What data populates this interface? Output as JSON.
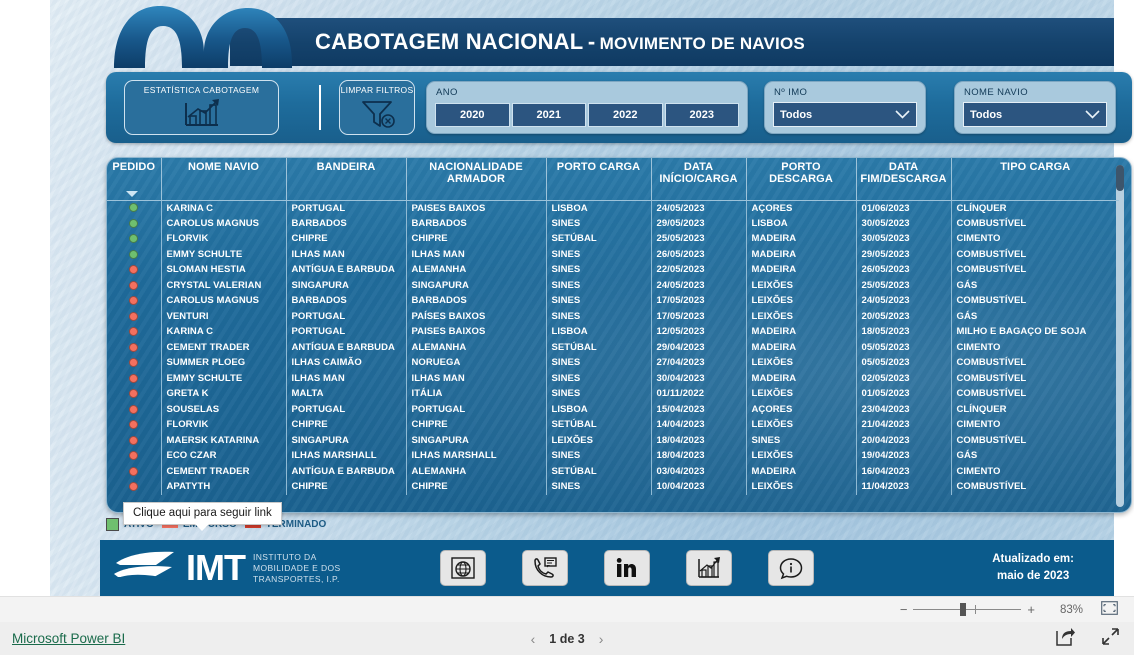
{
  "header": {
    "title_main": "CABOTAGEM NACIONAL",
    "title_dash": "-",
    "title_sub": "MOVIMENTO DE NAVIOS"
  },
  "filters": {
    "estatistica_button": "ESTATÍSTICA CABOTAGEM",
    "limpar_button": "LIMPAR FILTROS",
    "ano_label": "ANO",
    "years": [
      "2020",
      "2021",
      "2022",
      "2023"
    ],
    "imo_label": "Nº IMO",
    "imo_value": "Todos",
    "navio_label": "NOME NAVIO",
    "navio_value": "Todos"
  },
  "table": {
    "columns": [
      "PEDIDO",
      "NOME NAVIO",
      "BANDEIRA",
      "NACIONALIDADE ARMADOR",
      "PORTO CARGA",
      "DATA INÍCIO/CARGA",
      "PORTO DESCARGA",
      "DATA FIM/DESCARGA",
      "TIPO CARGA"
    ],
    "status_colors": {
      "green": "#6fbf6f",
      "red": "#f4705f"
    },
    "rows": [
      {
        "status": "green",
        "navio": "KARINA C",
        "bandeira": "PORTUGAL",
        "nacionalidade": "PAISES BAIXOS",
        "porto_carga": "LISBOA",
        "data_inicio": "24/05/2023",
        "porto_descarga": "AÇORES",
        "data_fim": "01/06/2023",
        "tipo_carga": "CLÍNQUER"
      },
      {
        "status": "green",
        "navio": "CAROLUS MAGNUS",
        "bandeira": "BARBADOS",
        "nacionalidade": "BARBADOS",
        "porto_carga": "SINES",
        "data_inicio": "29/05/2023",
        "porto_descarga": "LISBOA",
        "data_fim": "30/05/2023",
        "tipo_carga": "COMBUSTÍVEL"
      },
      {
        "status": "green",
        "navio": "FLORVIK",
        "bandeira": "CHIPRE",
        "nacionalidade": "CHIPRE",
        "porto_carga": "SETÚBAL",
        "data_inicio": "25/05/2023",
        "porto_descarga": "MADEIRA",
        "data_fim": "30/05/2023",
        "tipo_carga": "CIMENTO"
      },
      {
        "status": "green",
        "navio": "EMMY SCHULTE",
        "bandeira": "ILHAS MAN",
        "nacionalidade": "ILHAS MAN",
        "porto_carga": "SINES",
        "data_inicio": "26/05/2023",
        "porto_descarga": "MADEIRA",
        "data_fim": "29/05/2023",
        "tipo_carga": "COMBUSTÍVEL"
      },
      {
        "status": "red",
        "navio": "SLOMAN HESTIA",
        "bandeira": "ANTÍGUA E BARBUDA",
        "nacionalidade": "ALEMANHA",
        "porto_carga": "SINES",
        "data_inicio": "22/05/2023",
        "porto_descarga": "MADEIRA",
        "data_fim": "26/05/2023",
        "tipo_carga": "COMBUSTÍVEL"
      },
      {
        "status": "red",
        "navio": "CRYSTAL VALERIAN",
        "bandeira": "SINGAPURA",
        "nacionalidade": "SINGAPURA",
        "porto_carga": "SINES",
        "data_inicio": "24/05/2023",
        "porto_descarga": "LEIXÕES",
        "data_fim": "25/05/2023",
        "tipo_carga": "GÁS"
      },
      {
        "status": "red",
        "navio": "CAROLUS MAGNUS",
        "bandeira": "BARBADOS",
        "nacionalidade": "BARBADOS",
        "porto_carga": "SINES",
        "data_inicio": "17/05/2023",
        "porto_descarga": "LEIXÕES",
        "data_fim": "24/05/2023",
        "tipo_carga": "COMBUSTÍVEL"
      },
      {
        "status": "red",
        "navio": "VENTURI",
        "bandeira": "PORTUGAL",
        "nacionalidade": "PAÍSES BAIXOS",
        "porto_carga": "SINES",
        "data_inicio": "17/05/2023",
        "porto_descarga": "LEIXÕES",
        "data_fim": "20/05/2023",
        "tipo_carga": "GÁS"
      },
      {
        "status": "red",
        "navio": "KARINA C",
        "bandeira": "PORTUGAL",
        "nacionalidade": "PAISES BAIXOS",
        "porto_carga": "LISBOA",
        "data_inicio": "12/05/2023",
        "porto_descarga": "MADEIRA",
        "data_fim": "18/05/2023",
        "tipo_carga": "MILHO E BAGAÇO DE SOJA"
      },
      {
        "status": "red",
        "navio": "CEMENT TRADER",
        "bandeira": "ANTÍGUA E BARBUDA",
        "nacionalidade": "ALEMANHA",
        "porto_carga": "SETÚBAL",
        "data_inicio": "29/04/2023",
        "porto_descarga": "MADEIRA",
        "data_fim": "05/05/2023",
        "tipo_carga": "CIMENTO"
      },
      {
        "status": "red",
        "navio": "SUMMER PLOEG",
        "bandeira": "ILHAS CAIMÃO",
        "nacionalidade": "NORUEGA",
        "porto_carga": "SINES",
        "data_inicio": "27/04/2023",
        "porto_descarga": "LEIXÕES",
        "data_fim": "05/05/2023",
        "tipo_carga": "COMBUSTÍVEL"
      },
      {
        "status": "red",
        "navio": "EMMY SCHULTE",
        "bandeira": "ILHAS MAN",
        "nacionalidade": "ILHAS MAN",
        "porto_carga": "SINES",
        "data_inicio": "30/04/2023",
        "porto_descarga": "MADEIRA",
        "data_fim": "02/05/2023",
        "tipo_carga": "COMBUSTÍVEL"
      },
      {
        "status": "red",
        "navio": "GRETA K",
        "bandeira": "MALTA",
        "nacionalidade": "ITÁLIA",
        "porto_carga": "SINES",
        "data_inicio": "01/11/2022",
        "porto_descarga": "LEIXÕES",
        "data_fim": "01/05/2023",
        "tipo_carga": "COMBUSTÍVEL"
      },
      {
        "status": "red",
        "navio": "SOUSELAS",
        "bandeira": "PORTUGAL",
        "nacionalidade": "PORTUGAL",
        "porto_carga": "LISBOA",
        "data_inicio": "15/04/2023",
        "porto_descarga": "AÇORES",
        "data_fim": "23/04/2023",
        "tipo_carga": "CLÍNQUER"
      },
      {
        "status": "red",
        "navio": "FLORVIK",
        "bandeira": "CHIPRE",
        "nacionalidade": "CHIPRE",
        "porto_carga": "SETÚBAL",
        "data_inicio": "14/04/2023",
        "porto_descarga": "LEIXÕES",
        "data_fim": "21/04/2023",
        "tipo_carga": "CIMENTO"
      },
      {
        "status": "red",
        "navio": "MAERSK KATARINA",
        "bandeira": "SINGAPURA",
        "nacionalidade": "SINGAPURA",
        "porto_carga": "LEIXÕES",
        "data_inicio": "18/04/2023",
        "porto_descarga": "SINES",
        "data_fim": "20/04/2023",
        "tipo_carga": "COMBUSTÍVEL"
      },
      {
        "status": "red",
        "navio": "ECO CZAR",
        "bandeira": "ILHAS MARSHALL",
        "nacionalidade": "ILHAS MARSHALL",
        "porto_carga": "SINES",
        "data_inicio": "18/04/2023",
        "porto_descarga": "LEIXÕES",
        "data_fim": "19/04/2023",
        "tipo_carga": "GÁS"
      },
      {
        "status": "red",
        "navio": "CEMENT TRADER",
        "bandeira": "ANTÍGUA E BARBUDA",
        "nacionalidade": "ALEMANHA",
        "porto_carga": "SETÚBAL",
        "data_inicio": "03/04/2023",
        "porto_descarga": "MADEIRA",
        "data_fim": "16/04/2023",
        "tipo_carga": "CIMENTO"
      },
      {
        "status": "red",
        "navio": "APATYTH",
        "bandeira": "CHIPRE",
        "nacionalidade": "CHIPRE",
        "porto_carga": "SINES",
        "data_inicio": "10/04/2023",
        "porto_descarga": "LEIXÕES",
        "data_fim": "11/04/2023",
        "tipo_carga": "COMBUSTÍVEL"
      }
    ]
  },
  "legend": {
    "items": [
      {
        "label": "ATIVO",
        "color": "#6fbf6f",
        "shape": "square"
      },
      {
        "label": "EM CURSO",
        "color": "#f4705f",
        "shape": "bar"
      },
      {
        "label": "TERMINADO",
        "color": "#cf3b2b",
        "shape": "bar"
      }
    ]
  },
  "tooltip": {
    "text": "Clique aqui para seguir link"
  },
  "footer": {
    "logo_text": "IMT",
    "logo_sub_line1": "INSTITUTO DA",
    "logo_sub_line2": "MOBILIDADE E DOS",
    "logo_sub_line3": "TRANSPORTES, I.P.",
    "social": [
      {
        "name": "globe-icon"
      },
      {
        "name": "contact-phone-icon"
      },
      {
        "name": "linkedin-icon"
      },
      {
        "name": "statistics-chart-icon"
      },
      {
        "name": "info-icon"
      }
    ],
    "updated_line1": "Atualizado em:",
    "updated_line2": "maio de 2023"
  },
  "powerbi": {
    "zoom_minus": "−",
    "zoom_plus": "+",
    "zoom_pct": "83%",
    "brand": "Microsoft Power BI",
    "page_prev": "‹",
    "page_label": "1 de 3",
    "page_next": "›"
  }
}
